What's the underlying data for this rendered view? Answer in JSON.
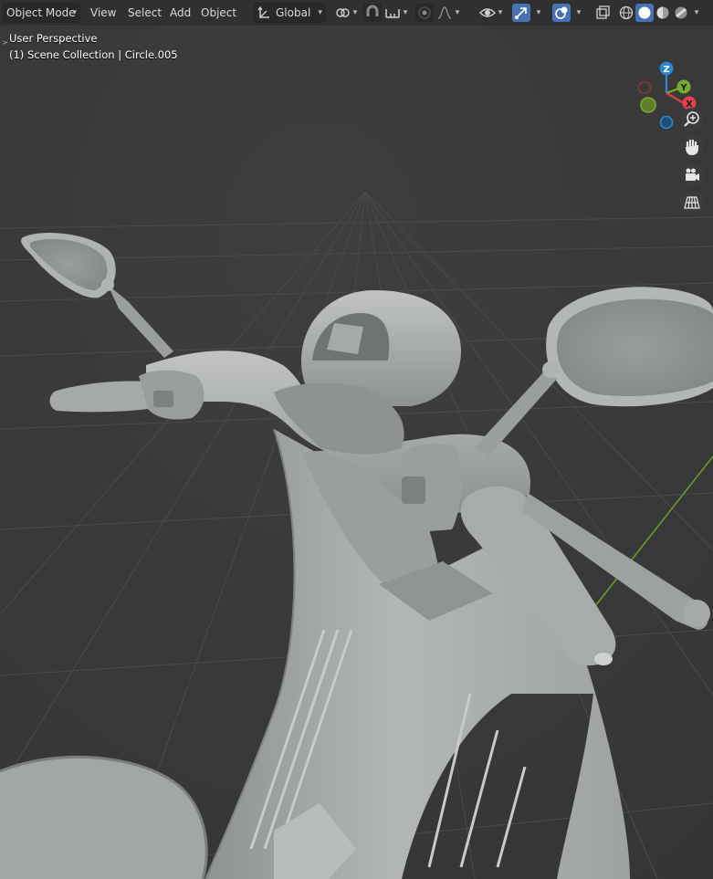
{
  "header": {
    "mode": "Object Mode",
    "menus": [
      "View",
      "Select",
      "Add",
      "Object"
    ],
    "orientation": "Global"
  },
  "viewport": {
    "view_name": "User Perspective",
    "collection_info": "(1) Scene Collection | Circle.005"
  },
  "gizmo": {
    "z_label": "Z",
    "y_label": "Y",
    "x_label": "X",
    "colors": {
      "x": "#e0404e",
      "y": "#7bab2b",
      "z": "#2d86cf"
    }
  },
  "nav_icons": [
    "zoom-icon",
    "hand-icon",
    "camera-icon",
    "grid-icon"
  ],
  "colors": {
    "header_bg": "#303030",
    "viewport_bg": "#393939",
    "accent": "#4772b3",
    "model": "#a3a6a6"
  }
}
